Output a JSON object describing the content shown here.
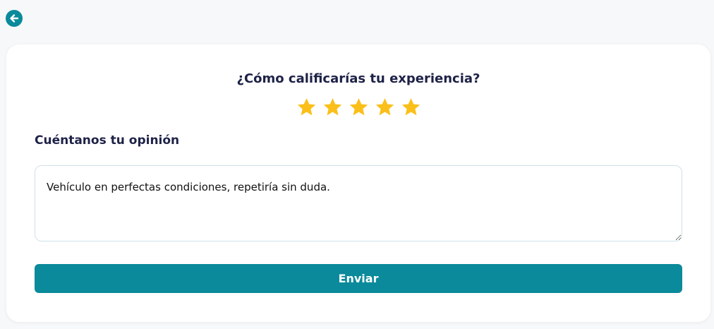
{
  "nav": {
    "back_icon": "arrow-left-icon"
  },
  "rating": {
    "question": "¿Cómo calificarías tu experiencia?",
    "value": 5,
    "max": 5,
    "star_color": "#fbbf1a"
  },
  "feedback": {
    "label": "Cuéntanos tu opinión",
    "value": "Vehículo en perfectas condiciones, repetiría sin duda."
  },
  "actions": {
    "submit_label": "Enviar"
  },
  "colors": {
    "accent": "#0a8a9b",
    "heading": "#1e2247",
    "background": "#f7f8fa",
    "card": "#ffffff"
  }
}
